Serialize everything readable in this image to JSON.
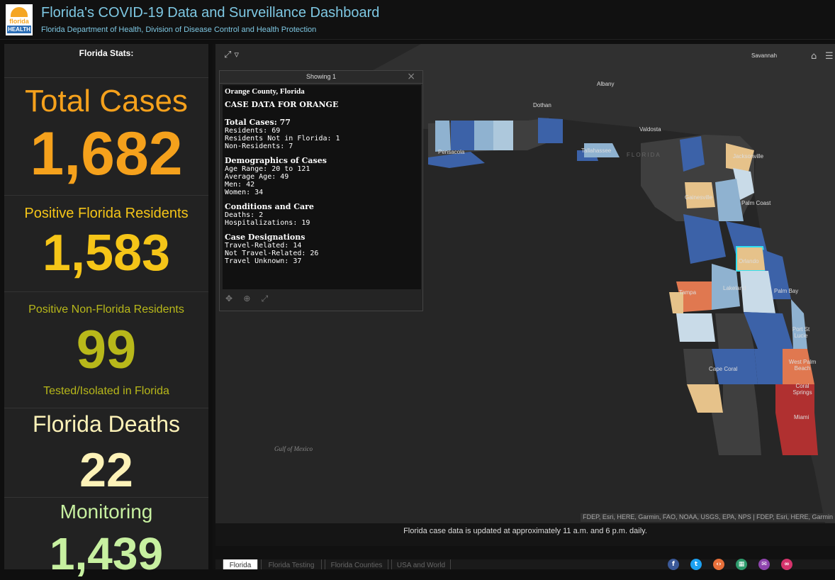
{
  "header": {
    "title": "Florida's COVID-19 Data and Surveillance Dashboard",
    "subtitle": "Florida Department of Health, Division of Disease Control and Health Protection",
    "logo_text_top": "florida",
    "logo_text_bottom": "HEALTH"
  },
  "stats": {
    "heading": "Florida Stats:",
    "total_cases_label": "Total Cases",
    "total_cases_value": "1,682",
    "positive_residents_label": "Positive Florida Residents",
    "positive_residents_value": "1,583",
    "positive_nonresidents_label": "Positive Non-Florida Residents",
    "positive_nonresidents_value": "99",
    "positive_nonresidents_sub": "Tested/Isolated in Florida",
    "deaths_label": "Florida Deaths",
    "deaths_value": "22",
    "monitoring_label": "Monitoring",
    "monitoring_value": "1,439"
  },
  "colors": {
    "total_cases": "#f5a11c",
    "positive_residents": "#f5c518",
    "positive_nonresidents": "#b8b81a",
    "deaths": "#fdf2b8",
    "monitoring": "#c7f0a0",
    "header_text": "#7ec8e3"
  },
  "map": {
    "city_labels": [
      "Savannah",
      "Albany",
      "Dothan",
      "Valdosta",
      "Pensacola",
      "Tallahassee",
      "Jacksonville",
      "Gainesville",
      "Palm Coast",
      "Orlando",
      "Tampa",
      "Lakeland",
      "Palm Bay",
      "Port St Lucie",
      "West Palm Beach",
      "Coral Springs",
      "Cape Coral",
      "Miami"
    ],
    "faint_label": "FLORIDA",
    "water_label": "Gulf of Mexico",
    "attribution": "FDEP, Esri, HERE, Garmin, FAO, NOAA, USGS, EPA, NPS | FDEP, Esri, HERE, Garmin",
    "update_note": "Florida case data is updated at approximately 11 a.m. and 6 p.m. daily."
  },
  "popup": {
    "showing": "Showing 1",
    "title": "Orange County, Florida",
    "heading": "CASE DATA FOR ORANGE",
    "sections": [
      {
        "head": "Total Cases: 77",
        "lines": [
          "Residents: 69",
          "Residents Not in Florida: 1",
          "Non-Residents: 7"
        ]
      },
      {
        "head": "Demographics of Cases",
        "lines": [
          "Age Range: 20 to 121",
          "Average Age: 49",
          "Men: 42",
          "Women: 34"
        ]
      },
      {
        "head": "Conditions and Care",
        "lines": [
          "Deaths: 2",
          "Hospitalizations: 19"
        ]
      },
      {
        "head": "Case Designations",
        "lines": [
          "Travel-Related: 14",
          "Not Travel-Related: 26",
          "Travel Unknown: 37"
        ]
      }
    ]
  },
  "tabs": [
    "Florida",
    "Florida Testing",
    "Florida Counties",
    "USA and World"
  ],
  "social_icons": [
    "facebook-icon",
    "twitter-icon",
    "embed-icon",
    "qr-icon",
    "email-icon",
    "link-icon"
  ]
}
